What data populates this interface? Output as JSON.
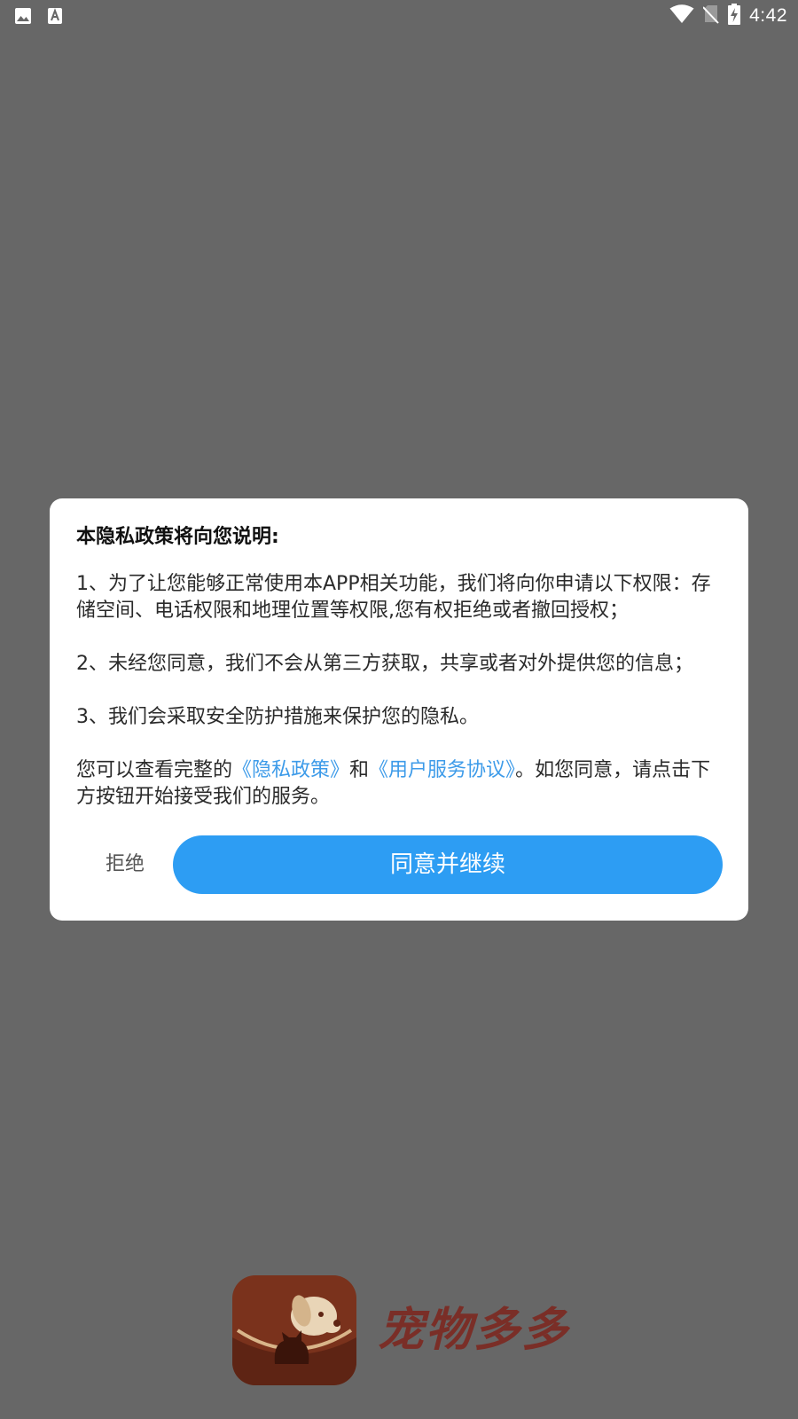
{
  "status_bar": {
    "time": "4:42",
    "left_icons": [
      "image-icon",
      "font-icon"
    ],
    "right_icons": [
      "wifi-icon",
      "no-sim-icon",
      "battery-charging-icon"
    ]
  },
  "dialog": {
    "title": "本隐私政策将向您说明:",
    "paragraph1": "1、为了让您能够正常使用本APP相关功能，我们将向你申请以下权限：存储空间、电话权限和地理位置等权限,您有权拒绝或者撤回授权；",
    "paragraph2": "2、未经您同意，我们不会从第三方获取，共享或者对外提供您的信息；",
    "paragraph3": "3、我们会采取安全防护措施来保护您的隐私。",
    "paragraph4": {
      "prefix": "您可以查看完整的",
      "privacy_link": "《隐私政策》",
      "conjunction": "和",
      "terms_link": "《用户服务协议》",
      "suffix": "。如您同意，请点击下方按钮开始接受我们的服务。"
    },
    "reject_label": "拒绝",
    "agree_label": "同意并继续"
  },
  "branding": {
    "app_name": "宠物多多",
    "logo_icon": "pet-dog-cat-logo-icon"
  },
  "colors": {
    "overlay": "#676767",
    "accent": "#2d9df3",
    "link": "#3d9be9",
    "logo_bg": "#7a321c",
    "brand_text": "#7a2e27"
  }
}
